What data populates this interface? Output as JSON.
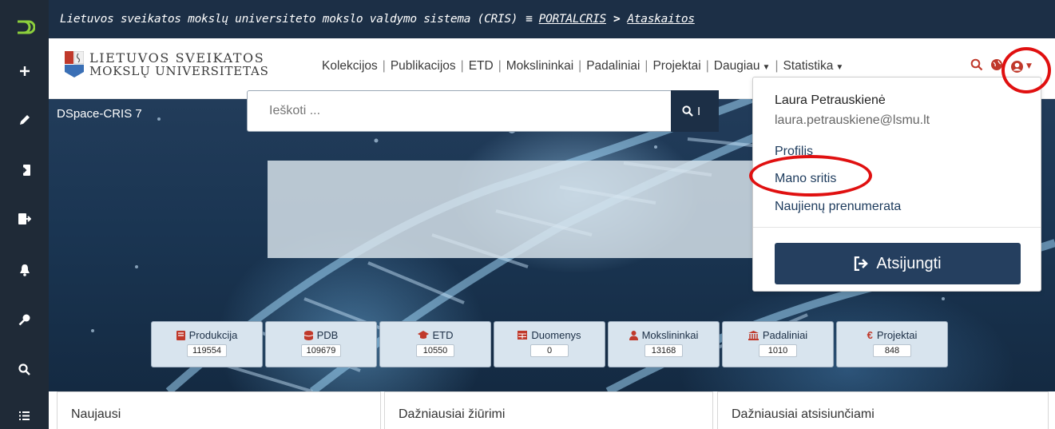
{
  "topbar": {
    "system_name": "Lietuvos sveikatos mokslų universiteto mokslo valdymo sistema (CRIS)",
    "breadcrumb": [
      "PORTALCRIS",
      "Ataskaitos"
    ]
  },
  "sidebar": {
    "items": [
      {
        "icon": "add-icon"
      },
      {
        "icon": "pencil-icon"
      },
      {
        "icon": "import-icon"
      },
      {
        "icon": "export-icon"
      },
      {
        "icon": "bell-icon"
      },
      {
        "icon": "key-icon"
      },
      {
        "icon": "search-icon"
      },
      {
        "icon": "list-icon"
      }
    ]
  },
  "logo": {
    "line1": "LIETUVOS SVEIKATOS",
    "line2": "MOKSLŲ UNIVERSITETAS"
  },
  "nav": {
    "items": [
      "Kolekcijos",
      "Publikacijos",
      "ETD",
      "Mokslininkai",
      "Padaliniai",
      "Projektai",
      "Daugiau",
      "Statistika"
    ]
  },
  "hero": {
    "title": "DSpace-CRIS 7",
    "search_placeholder": "Ieškoti ...",
    "search_button": "I"
  },
  "stats": [
    {
      "label": "Produkcija",
      "count": "119554",
      "icon": "book-icon",
      "color": "#c0392b"
    },
    {
      "label": "PDB",
      "count": "109679",
      "icon": "database-icon",
      "color": "#c0392b"
    },
    {
      "label": "ETD",
      "count": "10550",
      "icon": "graduation-cap-icon",
      "color": "#c0392b"
    },
    {
      "label": "Duomenys",
      "count": "0",
      "icon": "table-icon",
      "color": "#c0392b"
    },
    {
      "label": "Mokslininkai",
      "count": "13168",
      "icon": "user-icon",
      "color": "#c0392b"
    },
    {
      "label": "Padaliniai",
      "count": "1010",
      "icon": "institution-icon",
      "color": "#c0392b"
    },
    {
      "label": "Projektai",
      "count": "848",
      "icon": "euro-icon",
      "color": "#c0392b"
    }
  ],
  "cards": [
    "Naujausi",
    "Dažniausiai žiūrimi",
    "Dažniausiai atsisiunčiami"
  ],
  "user_menu": {
    "name": "Laura Petrauskienė",
    "email": "laura.petrauskiene@lsmu.lt",
    "items": [
      "Profilis",
      "Mano sritis",
      "Naujienų prenumerata"
    ],
    "logout": "Atsijungti"
  },
  "colors": {
    "primary": "#1c2f46",
    "annotation": "#e01010",
    "stat_icon": "#c0392b"
  }
}
